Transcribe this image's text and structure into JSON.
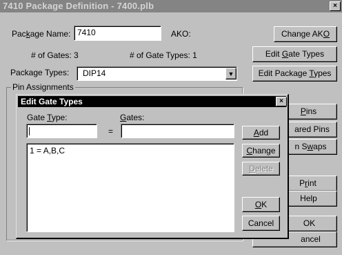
{
  "window": {
    "title": "7410 Package Definition - 7400.plb",
    "close_glyph": "×"
  },
  "package": {
    "name_label_pre": "Pac",
    "name_label_u": "k",
    "name_label_post": "age Name:",
    "name_value": "7410",
    "ako_label": "AKO:",
    "gates_text": "# of Gates: 3",
    "gate_types_text": "# of Gate Types: 1",
    "types_label": "Package Types:",
    "types_value": "DIP14",
    "pin_assignments_label": "Pin Assignments"
  },
  "buttons": {
    "change_ako_pre": "Change AK",
    "change_ako_u": "O",
    "edit_gate_types_pre": "Edit ",
    "edit_gate_types_u": "G",
    "edit_gate_types_post": "ate Types",
    "edit_package_types_pre": "Edit Package ",
    "edit_package_types_u": "T",
    "edit_package_types_post": "ypes",
    "pins_partial_u": "P",
    "pins_partial_post": "ins",
    "shared_pins_partial": "ared Pins",
    "swaps_partial_pre": "n S",
    "swaps_partial_u": "w",
    "swaps_partial_post": "aps",
    "print_partial_pre": "P",
    "print_partial_u": "r",
    "print_partial_post": "int",
    "help_partial": "Help",
    "ok_partial": "OK",
    "cancel_partial": "ancel"
  },
  "dialog": {
    "title": "Edit Gate Types",
    "gate_type_label_pre": "Gate ",
    "gate_type_label_u": "T",
    "gate_type_label_post": "ype:",
    "gates_label_u": "G",
    "gates_label_post": "ates:",
    "equals": "=",
    "list_items": [
      "1 = A,B,C"
    ],
    "add_u": "A",
    "add_post": "dd",
    "change_u": "C",
    "change_post": "hange",
    "delete_u": "D",
    "delete_post": "elete",
    "ok_u": "O",
    "ok_post": "K",
    "cancel": "Cancel",
    "close_glyph": "×"
  }
}
